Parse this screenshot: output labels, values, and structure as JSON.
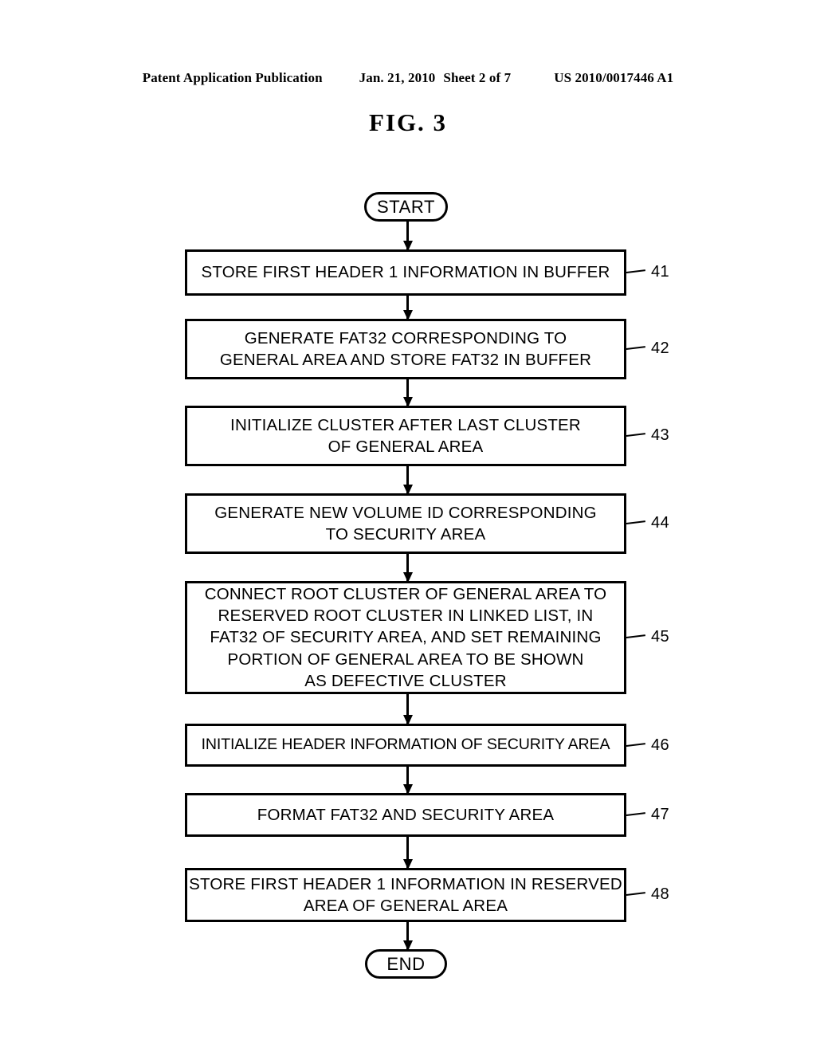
{
  "page_header": {
    "publication": "Patent Application Publication",
    "date": "Jan. 21, 2010",
    "sheet": "Sheet 2 of 7",
    "document_number": "US 2010/0017446 A1"
  },
  "figure": {
    "title": "FIG.  3"
  },
  "flowchart": {
    "start_label": "START",
    "end_label": "END",
    "steps": [
      {
        "ref": "41",
        "text": "STORE FIRST HEADER 1 INFORMATION IN BUFFER"
      },
      {
        "ref": "42",
        "text": "GENERATE FAT32 CORRESPONDING TO\nGENERAL AREA AND STORE FAT32 IN BUFFER"
      },
      {
        "ref": "43",
        "text": "INITIALIZE CLUSTER AFTER LAST CLUSTER\nOF GENERAL AREA"
      },
      {
        "ref": "44",
        "text": "GENERATE NEW VOLUME ID CORRESPONDING\nTO SECURITY AREA"
      },
      {
        "ref": "45",
        "text": "CONNECT ROOT CLUSTER OF GENERAL AREA TO\nRESERVED ROOT CLUSTER IN LINKED LIST, IN\nFAT32 OF SECURITY AREA, AND SET REMAINING\nPORTION OF GENERAL AREA TO BE SHOWN\nAS DEFECTIVE CLUSTER"
      },
      {
        "ref": "46",
        "text": "INITIALIZE HEADER INFORMATION OF SECURITY AREA"
      },
      {
        "ref": "47",
        "text": "FORMAT FAT32 AND SECURITY AREA"
      },
      {
        "ref": "48",
        "text": "STORE FIRST HEADER 1 INFORMATION IN RESERVED\nAREA OF GENERAL AREA"
      }
    ]
  },
  "colors": {
    "ink": "#000000",
    "paper": "#ffffff"
  }
}
